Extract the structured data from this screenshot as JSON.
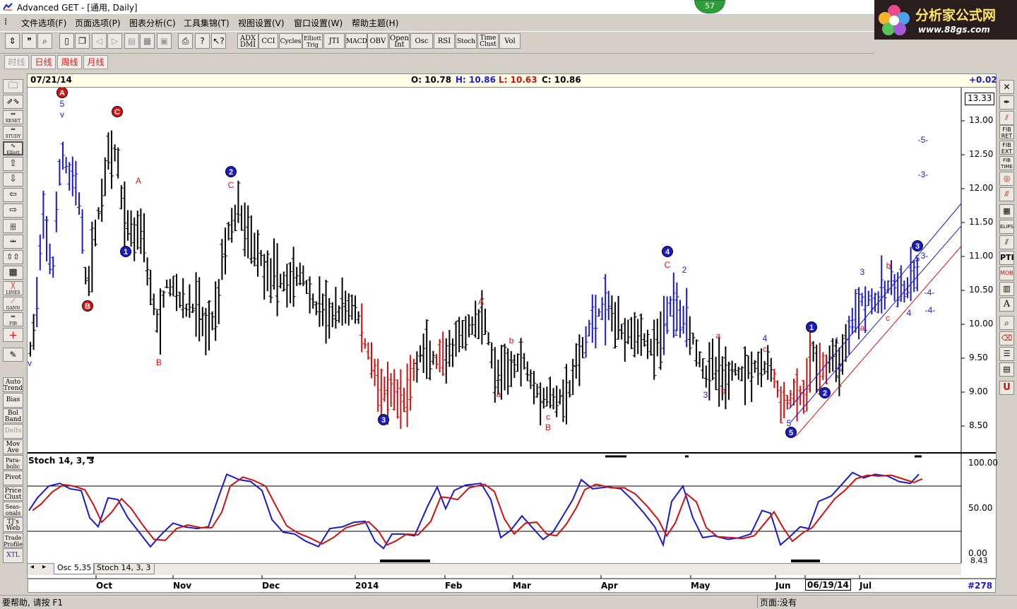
{
  "window": {
    "title": "Advanced GET - [通用, Daily]",
    "badge": "57"
  },
  "logo": {
    "title": "分析家公式网",
    "url": "www.88gs.com"
  },
  "menu": [
    "文件选项(F)",
    "页面选项(P)",
    "图表分析(C)",
    "工具集锦(T)",
    "视图设置(V)",
    "窗口设置(W)",
    "帮助主题(H)"
  ],
  "toolbar": {
    "icons": [
      "pointer-icon",
      "quote-icon",
      "search-icon",
      "new-icon",
      "copy-icon",
      "back-icon",
      "forward-icon",
      "print-preview-icon",
      "grid-icon",
      "save-icon",
      "print-icon",
      "help-icon",
      "context-help-icon"
    ],
    "studies": [
      "ADX DMI",
      "CCI",
      "Cycles",
      "Elliott Trig",
      "JTI",
      "MACD",
      "OBV",
      "Open Int",
      "Osc",
      "RSI",
      "Stoch",
      "Time Clust",
      "Vol"
    ]
  },
  "periods": [
    {
      "label": "时线",
      "active": false
    },
    {
      "label": "日线",
      "active": true
    },
    {
      "label": "周线",
      "active": true
    },
    {
      "label": "月线",
      "active": true
    }
  ],
  "left_tools": [
    "Auto Trend",
    "Bias",
    "Bol Band",
    "Delts",
    "Mov Ave",
    "Para-bolic",
    "Pivot",
    "Price Clust",
    "Seas-onals",
    "TJ's Web",
    "Trade Profile",
    "XTL"
  ],
  "left_tools_top": [
    "RESET",
    "STUDY",
    "Elliott",
    "LINES",
    "GANN",
    "FIB"
  ],
  "right_tools": [
    "FIB RET",
    "FIB EXT",
    "FIB TIME",
    "ELIPS",
    "PTI",
    "MOB",
    "A"
  ],
  "header": {
    "date": "07/21/14",
    "open": "O: 10.78",
    "high": "H: 10.86",
    "low": "L: 10.63",
    "close": "C: 10.86",
    "change": "+0.02"
  },
  "price_axis": {
    "current": "13.33",
    "ticks": [
      "13.00",
      "12.50",
      "12.00",
      "11.50",
      "11.00",
      "10.50",
      "10.00",
      "9.50",
      "9.00",
      "8.50"
    ]
  },
  "osc_axis": {
    "ticks": [
      "100.00",
      "50.00",
      "0.00"
    ],
    "bottom": "8.43"
  },
  "time_axis": {
    "labels": [
      "Oct",
      "Nov",
      "Dec",
      "2014",
      "Feb",
      "Mar",
      "Apr",
      "May",
      "Jun",
      "06/19/14",
      "Jul"
    ],
    "bar_count": "#278"
  },
  "oscillator": {
    "label": "Stoch 14, 3, 3"
  },
  "tabs": [
    "Osc 5,35",
    "Stoch 14, 3, 3"
  ],
  "status": {
    "help": "要帮助, 请按 F1",
    "page": "页面:没有"
  },
  "colors": {
    "up": "#000000",
    "elliott_blue": "#1a1acc",
    "elliott_red": "#dd1111",
    "stoch_k": "#1a1acc",
    "stoch_d": "#cc1111"
  },
  "chart_data": {
    "type": "ohlc",
    "ylim": [
      8.3,
      13.33
    ],
    "osc_ylim": [
      0,
      100
    ],
    "wave_labels": [
      {
        "text": "A",
        "color": "red",
        "circle": true
      },
      {
        "text": "5",
        "color": "blue"
      },
      {
        "text": "v",
        "color": "blue"
      },
      {
        "text": "C",
        "color": "red",
        "circle": true
      },
      {
        "text": "A",
        "color": "red"
      },
      {
        "text": "1",
        "color": "blue",
        "circle": true
      },
      {
        "text": "B",
        "color": "red",
        "circle": true
      },
      {
        "text": "B",
        "color": "red"
      },
      {
        "text": "v",
        "color": "blue"
      },
      {
        "text": "2",
        "color": "blue",
        "circle": true
      },
      {
        "text": "C",
        "color": "red"
      },
      {
        "text": "3",
        "color": "blue",
        "circle": true
      },
      {
        "text": "A",
        "color": "red"
      },
      {
        "text": "a",
        "color": "red"
      },
      {
        "text": "b",
        "color": "red"
      },
      {
        "text": "c",
        "color": "red"
      },
      {
        "text": "B",
        "color": "red"
      },
      {
        "text": "4",
        "color": "blue",
        "circle": true
      },
      {
        "text": "C",
        "color": "red"
      },
      {
        "text": "2",
        "color": "blue"
      },
      {
        "text": "1",
        "color": "blue"
      },
      {
        "text": "3",
        "color": "blue"
      },
      {
        "text": "a",
        "color": "red"
      },
      {
        "text": "b",
        "color": "red"
      },
      {
        "text": "4",
        "color": "blue"
      },
      {
        "text": "c",
        "color": "red"
      },
      {
        "text": "5",
        "color": "blue"
      },
      {
        "text": "5",
        "color": "blue",
        "circle": true
      },
      {
        "text": "1",
        "color": "blue",
        "circle": true
      },
      {
        "text": "2",
        "color": "blue",
        "circle": true
      },
      {
        "text": "1",
        "color": "blue"
      },
      {
        "text": "2",
        "color": "blue"
      },
      {
        "text": "3",
        "color": "blue"
      },
      {
        "text": "a",
        "color": "red"
      },
      {
        "text": "b",
        "color": "red"
      },
      {
        "text": "c",
        "color": "red"
      },
      {
        "text": "4",
        "color": "blue"
      },
      {
        "text": "3",
        "color": "blue",
        "circle": true
      },
      {
        "text": "5",
        "color": "blue"
      },
      {
        "text": "-5-",
        "color": "blue"
      },
      {
        "text": "-3-",
        "color": "blue"
      },
      {
        "text": "3-",
        "color": "blue"
      },
      {
        "text": "-4-",
        "color": "blue"
      },
      {
        "text": "-4-",
        "color": "blue"
      }
    ]
  }
}
